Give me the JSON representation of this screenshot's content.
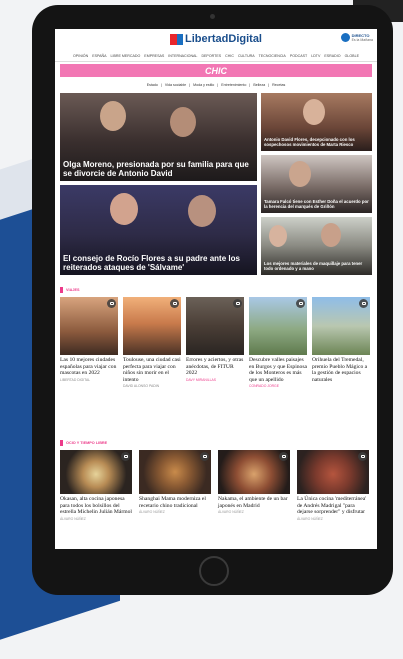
{
  "header": {
    "logo_text": "LibertadDigital",
    "directo_label": "DIRECTO",
    "directo_sub": "Es la Mañana"
  },
  "nav": {
    "items": [
      "Opinión",
      "España",
      "Libre Mercado",
      "Empresas",
      "Internacional",
      "Deportes",
      "Chic",
      "Cultura",
      "Tecnociencia",
      "Podcast",
      "LDTV",
      "Esradio",
      "Globle"
    ]
  },
  "section": {
    "title": "CHIC"
  },
  "subnav": {
    "items": [
      "Estado",
      "Vida sociable",
      "Moda y estilo",
      "Entretenimiento",
      "Belleza",
      "Recetas"
    ]
  },
  "hero": {
    "main": "Olga Moreno, presionada por su familia para que se divorcie de Antonio David",
    "side1": "Antonio David Flores, decepcionado con los sospechosos movimientos de Marta Riesco",
    "side2": "Tamara Falcó tiene con Esther Doña el acuerdo por la herencia del marqués de Griñón",
    "bottom": "El consejo de Rocío Flores a su padre ante los reiterados ataques de 'Sálvame'",
    "side3": "Los mejores materiales de maquillaje para tener todo ordenado y a mano"
  },
  "viajes": {
    "heading": "VIAJES",
    "cards": [
      {
        "title": "Las 10 mejores ciudades españolas para viajar con mascotas en 2022",
        "author": "LIBERTAD DIGITAL",
        "author_color": "grey"
      },
      {
        "title": "Toulouse, una ciudad casi perfecta para viajar con niños sin morir en el intento",
        "author": "DAVID ALONSO PADIN",
        "author_color": "grey"
      },
      {
        "title": "Errores y aciertos, y otras anécdotas, de FITUR 2022",
        "author": "DAVY MIRANILLAS",
        "author_color": "pink"
      },
      {
        "title": "Descubre valles paisajes en Burgos y que Espinosa de los Monteros es más que un apellido",
        "author": "CONRADO JORGE",
        "author_color": "pink"
      },
      {
        "title": "Orihuela del Tremedal, premio Pueblo Mágico a la gestión de espacios naturales",
        "author": "",
        "author_color": "grey"
      }
    ]
  },
  "ocio": {
    "heading": "OCIO Y TIEMPO LIBRE",
    "cards": [
      {
        "title": "Okasan, alta cocina japonesa para todos los bolsillos del estrella Michelin Julián Mármol",
        "author": "ÁLVARO NÚÑEZ"
      },
      {
        "title": "Shanghai Mama moderniza el recetario chino tradicional",
        "author": "ÁLVARO NÚÑEZ"
      },
      {
        "title": "Nakama, el ambiente de un bar japonés en Madrid",
        "author": "ÁLVARO NÚÑEZ"
      },
      {
        "title": "La Única cocina 'mediterránea' de Andrés Madrigal \"para dejarse sorprender\" y disfrutar",
        "author": "ÁLVARO NÚÑEZ"
      }
    ]
  },
  "colors": {
    "accent_pink": "#ec3b8a",
    "section_bar": "#f277b4",
    "brand_blue": "#1a4e8c",
    "brand_red": "#e8262c"
  }
}
